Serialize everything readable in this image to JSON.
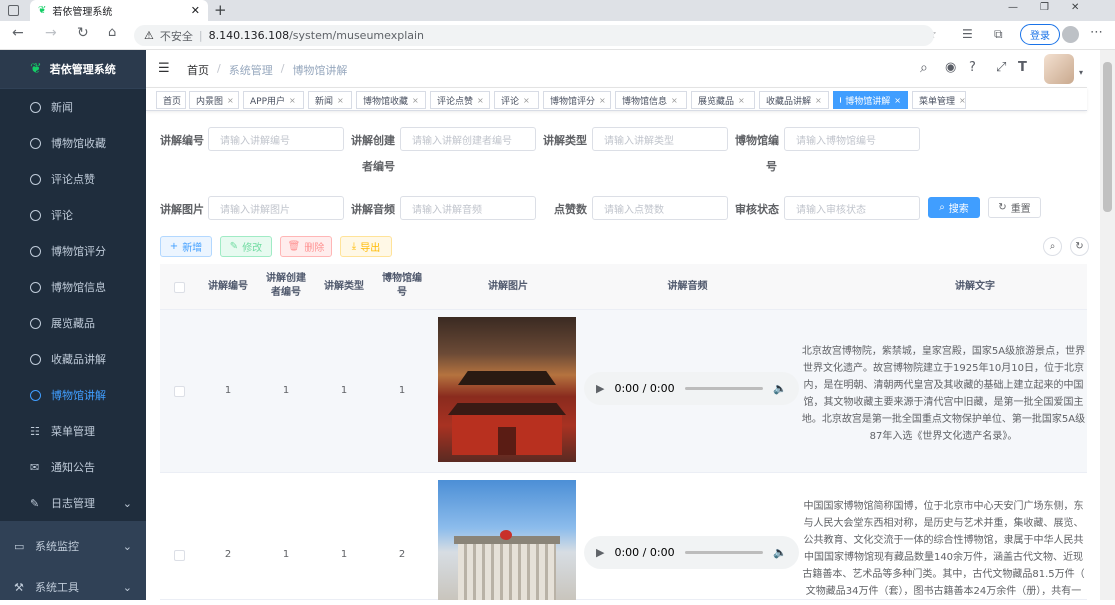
{
  "browser": {
    "tab_title": "若依管理系统",
    "insecure_label": "不安全",
    "url_host": "8.140.136.108",
    "url_path": "/system/museumexplain",
    "login_label": "登录"
  },
  "sidebar": {
    "logo_title": "若依管理系统",
    "items": [
      {
        "label": "新闻",
        "icon": "circle-icon"
      },
      {
        "label": "博物馆收藏",
        "icon": "circle-icon"
      },
      {
        "label": "评论点赞",
        "icon": "circle-icon"
      },
      {
        "label": "评论",
        "icon": "circle-icon"
      },
      {
        "label": "博物馆评分",
        "icon": "circle-icon"
      },
      {
        "label": "博物馆信息",
        "icon": "circle-icon"
      },
      {
        "label": "展览藏品",
        "icon": "circle-icon"
      },
      {
        "label": "收藏品讲解",
        "icon": "circle-icon"
      },
      {
        "label": "博物馆讲解",
        "icon": "circle-icon"
      },
      {
        "label": "菜单管理",
        "icon": "tree-icon"
      },
      {
        "label": "通知公告",
        "icon": "message-icon"
      },
      {
        "label": "日志管理",
        "icon": "log-icon"
      },
      {
        "label": "系统监控",
        "icon": "monitor-icon"
      },
      {
        "label": "系统工具",
        "icon": "tool-icon"
      }
    ]
  },
  "breadcrumb": [
    "首页",
    "系统管理",
    "博物馆讲解"
  ],
  "tags": [
    "首页",
    "内景图",
    "APP用户",
    "新闻",
    "博物馆收藏",
    "评论点赞",
    "评论",
    "博物馆评分",
    "博物馆信息",
    "展览藏品",
    "收藏品讲解",
    "博物馆讲解",
    "菜单管理"
  ],
  "search": {
    "f1_label": "讲解编号",
    "f1_ph": "请输入讲解编号",
    "f2_label_a": "讲解创建",
    "f2_label_b": "者编号",
    "f2_ph": "请输入讲解创建者编号",
    "f3_label": "讲解类型",
    "f3_ph": "请输入讲解类型",
    "f4_label_a": "博物馆编",
    "f4_label_b": "号",
    "f4_ph": "请输入博物馆编号",
    "f5_label": "讲解图片",
    "f5_ph": "请输入讲解图片",
    "f6_label": "讲解音频",
    "f6_ph": "请输入讲解音频",
    "f7_label": "点赞数",
    "f7_ph": "请输入点赞数",
    "f8_label": "审核状态",
    "f8_ph": "请输入审核状态",
    "search_btn": "搜索",
    "reset_btn": "重置"
  },
  "toolbar": {
    "add": "新增",
    "edit": "修改",
    "delete": "删除",
    "export": "导出"
  },
  "table": {
    "headers": {
      "id": "讲解编号",
      "creator_a": "讲解创建",
      "creator_b": "者编号",
      "type": "讲解类型",
      "museum_a": "博物馆编",
      "museum_b": "号",
      "image": "讲解图片",
      "audio": "讲解音频",
      "text": "讲解文字"
    },
    "rows": [
      {
        "id": "1",
        "creator": "1",
        "type": "1",
        "museum": "1",
        "audio_time": "0:00 / 0:00",
        "text_lines": [
          "北京故宫博物院，紫禁城，皇家宫殿，国家5A级旅游景点，世界",
          "世界文化遗产。故宫博物院建立于1925年10月10日，位于北京",
          "内，是在明朝、清朝两代皇宫及其收藏的基础上建立起来的中国",
          "馆，其文物收藏主要来源于清代宫中旧藏，是第一批全国爱国主",
          "地。北京故宫是第一批全国重点文物保护单位、第一批国家5A级",
          "87年入选《世界文化遗产名录》。"
        ]
      },
      {
        "id": "2",
        "creator": "1",
        "type": "1",
        "museum": "2",
        "audio_time": "0:00 / 0:00",
        "text_lines": [
          "中国国家博物馆简称国博，位于北京市中心天安门广场东侧，东",
          "与人民大会堂东西相对称，是历史与艺术并重，集收藏、展览、",
          "公共教育、文化交流于一体的综合性博物馆，隶属于中华人民共",
          "中国国家博物馆现有藏品数量140余万件，涵盖古代文物、近现",
          "古籍善本、艺术品等多种门类。其中，古代文物藏品81.5万件（",
          "文物藏品34万件（套），图书古籍善本24万余件（册），共有一"
        ]
      }
    ]
  },
  "colors": {
    "sidebar_bg": "#304156",
    "accent": "#409eff",
    "danger": "#ff4949",
    "success": "#13ce66",
    "warning": "#ffba00"
  }
}
